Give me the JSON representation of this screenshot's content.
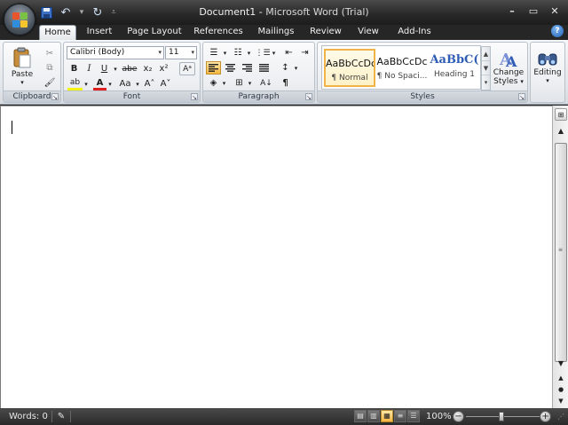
{
  "window": {
    "doc_name": "Document1",
    "app_name": "Microsoft Word (Trial)",
    "separator": " - ",
    "minimize": "–",
    "maximize": "▭",
    "close": "✕"
  },
  "quick_access": {
    "save_icon": "save-icon",
    "undo_glyph": "↶",
    "undo_dropdown": "▾",
    "redo_glyph": "↻",
    "customize": "⩡"
  },
  "tabs": [
    "Home",
    "Insert",
    "Page Layout",
    "References",
    "Mailings",
    "Review",
    "View",
    "Add-Ins"
  ],
  "active_tab": "Home",
  "help": "?",
  "clipboard": {
    "label": "Clipboard",
    "paste_label": "Paste",
    "paste_arrow": "▾",
    "cut_glyph": "✂",
    "copy_glyph": "⧉",
    "format_painter_glyph": "🖌"
  },
  "font": {
    "label": "Font",
    "font_name": "Calibri (Body)",
    "font_size": "11",
    "bold": "B",
    "italic": "I",
    "underline": "U",
    "strike": "abe",
    "subscript": "x₂",
    "superscript": "x²",
    "clear_format": "Aᵃ",
    "highlight": "ab",
    "font_color": "A",
    "change_case": "Aa",
    "grow": "A˄",
    "shrink": "A˅"
  },
  "paragraph": {
    "label": "Paragraph",
    "bullets": "☰",
    "numbering": "☷",
    "multilevel": "⋮☰",
    "decrease_indent": "⇤",
    "increase_indent": "⇥",
    "line_spacing": "↕",
    "shading": "◈",
    "borders": "⊞",
    "sort": "A↓",
    "show_marks": "¶"
  },
  "styles": {
    "label": "Styles",
    "items": [
      {
        "sample": "AaBbCcDc",
        "name": "¶ Normal"
      },
      {
        "sample": "AaBbCcDc",
        "name": "¶ No Spaci..."
      },
      {
        "sample": "AaBbC(",
        "name": "Heading 1"
      }
    ],
    "change_styles_line1": "Change",
    "change_styles_line2": "Styles",
    "change_arrow": "▾"
  },
  "editing": {
    "label": "Editing",
    "arrow": "▾"
  },
  "status": {
    "words": "Words: 0",
    "zoom": "100%",
    "zoom_fraction": 0.5
  },
  "colors": {
    "highlight": "#f4f413",
    "font_color": "#e02020",
    "accent": "#2f5db5"
  }
}
